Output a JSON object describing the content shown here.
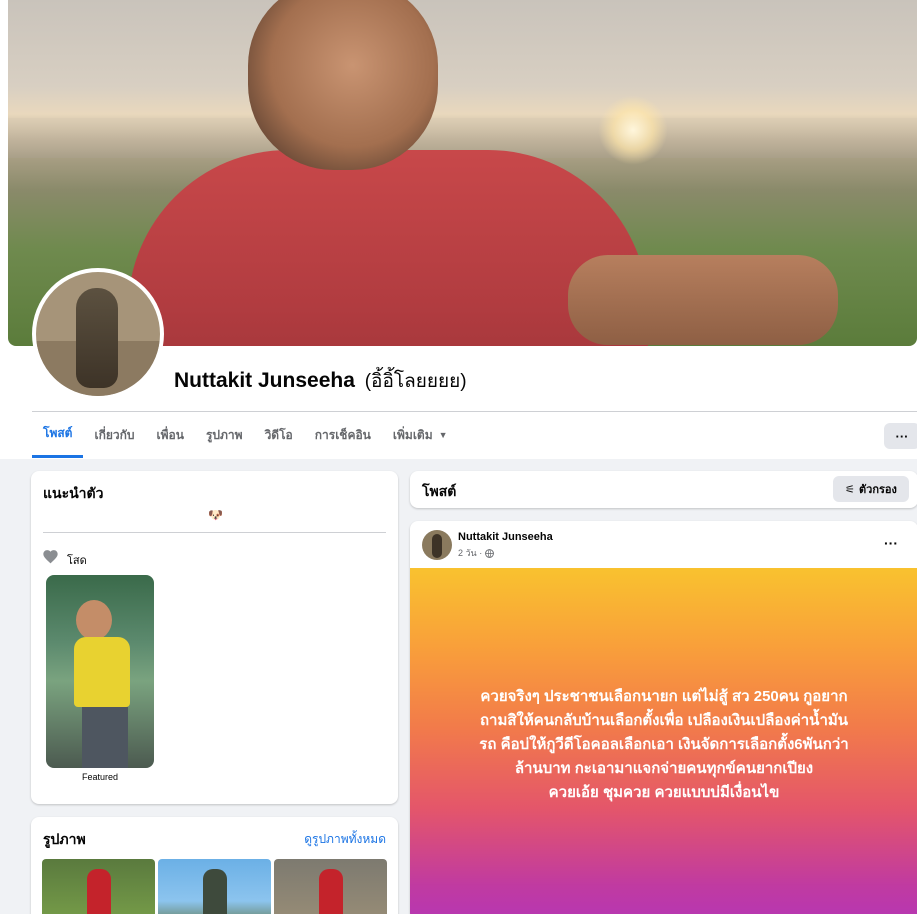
{
  "profile": {
    "name": "Nuttakit Junseeha",
    "nickname": "(อิ้อิ้โลยยยย)"
  },
  "tabs": [
    {
      "label": "โพสต์"
    },
    {
      "label": "เกี่ยวกับ"
    },
    {
      "label": "เพื่อน"
    },
    {
      "label": "รูปภาพ"
    },
    {
      "label": "วิดีโอ"
    },
    {
      "label": "การเช็คอิน"
    },
    {
      "label": "เพิ่มเติม"
    }
  ],
  "more_button": "···",
  "intro": {
    "title": "แนะนำตัว",
    "bio_emoji": "🐶",
    "relationship": "โสด",
    "featured_label": "Featured"
  },
  "photos": {
    "title": "รูปภาพ",
    "see_all": "ดูรูปภาพทั้งหมด"
  },
  "posts_header": {
    "title": "โพสต์",
    "filter_label": "ตัวกรอง"
  },
  "post": {
    "author": "Nuttakit Junseeha",
    "time": "2 วัน ·",
    "menu": "···",
    "text_lines": [
      "ควยจริงๆ ประชาชนเลือกนายก แต่ไม่สู้ สว 250คน กูอยาก",
      "ถามสิให้คนกลับบ้านเลือกตั้งเพื่อ เปลืองเงินเปลืองค่าน้ำมัน",
      "รถ คือบ่ให้กูวีดีโอคอลเลือกเอา เงินจัดการเลือกตั้ง6พันกว่า",
      "ล้านบาท กะเอามาแจกจ่ายคนทุกข์คนยากเปียง",
      "ควยเอ้ย ชุมควย ควยแบบบ่มีเงื่อนไข"
    ]
  },
  "colors": {
    "accent": "#1b74e4",
    "page_bg": "#f0f2f5",
    "banner_top": "#f9c22f",
    "banner_bottom": "#b637b3"
  }
}
